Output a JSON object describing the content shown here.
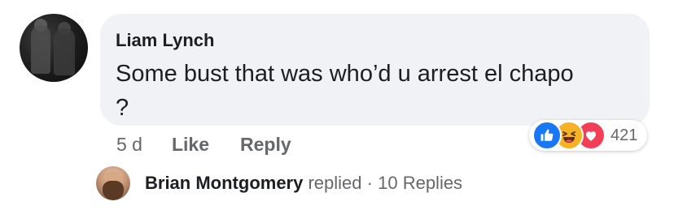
{
  "comment": {
    "author": "Liam Lynch",
    "text_line1": "Some bust that was who’d u arrest el chapo",
    "text_line2": "?",
    "time": "5 d",
    "like_label": "Like",
    "reply_label": "Reply"
  },
  "reactions": {
    "types": [
      "like-icon",
      "haha-icon",
      "love-icon"
    ],
    "colors": {
      "like": "#1877f2",
      "haha": "#f7b125",
      "love": "#f33e58"
    },
    "count": "421"
  },
  "replies": {
    "name": "Brian Montgomery",
    "verb": "replied",
    "separator": "·",
    "count_label": "10 Replies"
  }
}
